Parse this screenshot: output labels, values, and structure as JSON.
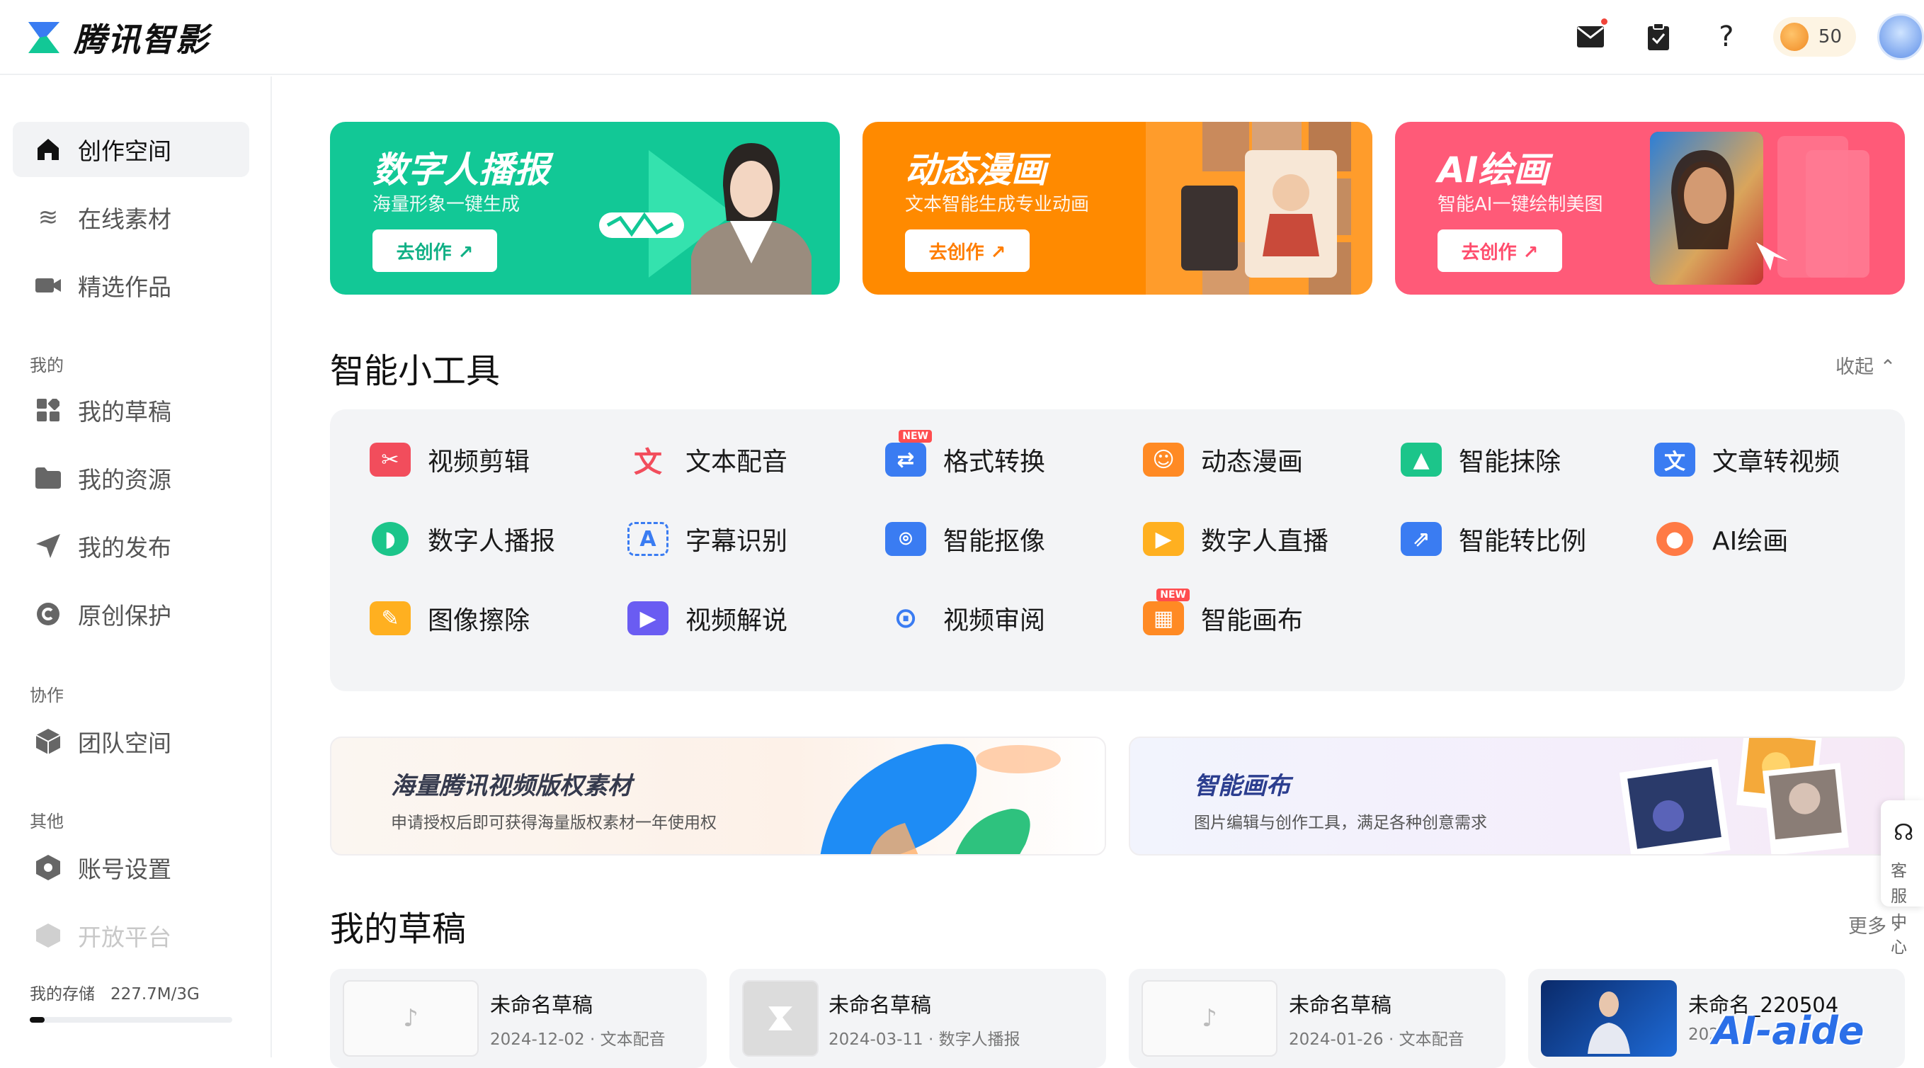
{
  "header": {
    "app_name": "腾讯智影",
    "coins": "50",
    "icons": [
      "mail-icon",
      "clipboard-icon",
      "help-icon",
      "coin-icon",
      "avatar"
    ]
  },
  "sidebar": {
    "items": [
      {
        "label": "创作空间",
        "icon": "home-icon",
        "active": true
      },
      {
        "label": "在线素材",
        "icon": "layers-icon"
      },
      {
        "label": "精选作品",
        "icon": "video-camera-icon"
      }
    ],
    "section_mine": "我的",
    "mine_items": [
      {
        "label": "我的草稿",
        "icon": "grid-icon"
      },
      {
        "label": "我的资源",
        "icon": "folder-icon"
      },
      {
        "label": "我的发布",
        "icon": "send-icon"
      },
      {
        "label": "原创保护",
        "icon": "copyright-icon"
      }
    ],
    "section_collab": "协作",
    "collab_items": [
      {
        "label": "团队空间",
        "icon": "cube-icon"
      }
    ],
    "section_other": "其他",
    "other_items": [
      {
        "label": "账号设置",
        "icon": "hexagon-icon"
      },
      {
        "label": "开放平台",
        "icon": "open-platform-icon"
      }
    ],
    "storage_label": "我的存储",
    "storage_value": "227.7M/3G",
    "storage_fraction": 0.074
  },
  "banners": [
    {
      "title": "数字人播报",
      "subtitle": "海量形象一键生成",
      "button": "去创作 ↗",
      "color": "#12c896"
    },
    {
      "title": "动态漫画",
      "subtitle": "文本智能生成专业动画",
      "button": "去创作 ↗",
      "color": "#ff8a00"
    },
    {
      "title": "AI绘画",
      "subtitle": "智能AI一键绘制美图",
      "button": "去创作 ↗",
      "color": "#ff5a78"
    }
  ],
  "tools_section": {
    "title": "智能小工具",
    "collapse": "收起 ⌃",
    "tools": [
      {
        "label": "视频剪辑",
        "icon": "video-edit-icon",
        "color": "#f24d5c"
      },
      {
        "label": "文本配音",
        "icon": "text-voice-icon",
        "color": "#f24d5c"
      },
      {
        "label": "格式转换",
        "icon": "format-convert-icon",
        "color": "#3a7cf2",
        "badge": "NEW"
      },
      {
        "label": "动态漫画",
        "icon": "dynamic-comic-icon",
        "color": "#ff8a24"
      },
      {
        "label": "智能抹除",
        "icon": "smart-erase-icon",
        "color": "#1cc58a"
      },
      {
        "label": "文章转视频",
        "icon": "article-to-video-icon",
        "color": "#3a7cf2",
        "glyph": "文"
      },
      {
        "label": "数字人播报",
        "icon": "digital-human-icon",
        "color": "#1cc58a"
      },
      {
        "label": "字幕识别",
        "icon": "subtitle-recognition-icon",
        "color": "#3a7cf2",
        "glyph": "A"
      },
      {
        "label": "智能抠像",
        "icon": "smart-matting-icon",
        "color": "#3a7cf2"
      },
      {
        "label": "数字人直播",
        "icon": "digital-live-icon",
        "color": "#ffb020"
      },
      {
        "label": "智能转比例",
        "icon": "aspect-ratio-icon",
        "color": "#3a7cf2"
      },
      {
        "label": "AI绘画",
        "icon": "palette-icon",
        "color": "#ff7a45"
      },
      {
        "label": "图像擦除",
        "icon": "image-erase-icon",
        "color": "#ffb020"
      },
      {
        "label": "视频解说",
        "icon": "video-narration-icon",
        "color": "#6a5cf2"
      },
      {
        "label": "视频审阅",
        "icon": "video-review-icon",
        "color": "#3a7cf2"
      },
      {
        "label": "智能画布",
        "icon": "smart-canvas-icon",
        "color": "#ff8a24",
        "badge": "NEW"
      }
    ]
  },
  "promos": [
    {
      "title": "海量腾讯视频版权素材",
      "subtitle": "申请授权后即可获得海量版权素材一年使用权"
    },
    {
      "title": "智能画布",
      "subtitle": "图片编辑与创作工具，满足各种创意需求"
    }
  ],
  "drafts_section": {
    "title": "我的草稿",
    "more": "更多 ›",
    "drafts": [
      {
        "name": "未命名草稿",
        "meta": "2024-12-02 · 文本配音",
        "thumb": "music-note-icon"
      },
      {
        "name": "未命名草稿",
        "meta": "2024-03-11 · 数字人播报",
        "thumb": "logo-icon"
      },
      {
        "name": "未命名草稿",
        "meta": "2024-01-26 · 文本配音",
        "thumb": "music-note-icon"
      },
      {
        "name": "未命名_220504",
        "meta": "202",
        "thumb": "news-anchor-image"
      }
    ]
  },
  "service": {
    "label": "客服中心"
  },
  "watermark": "AI-aide"
}
